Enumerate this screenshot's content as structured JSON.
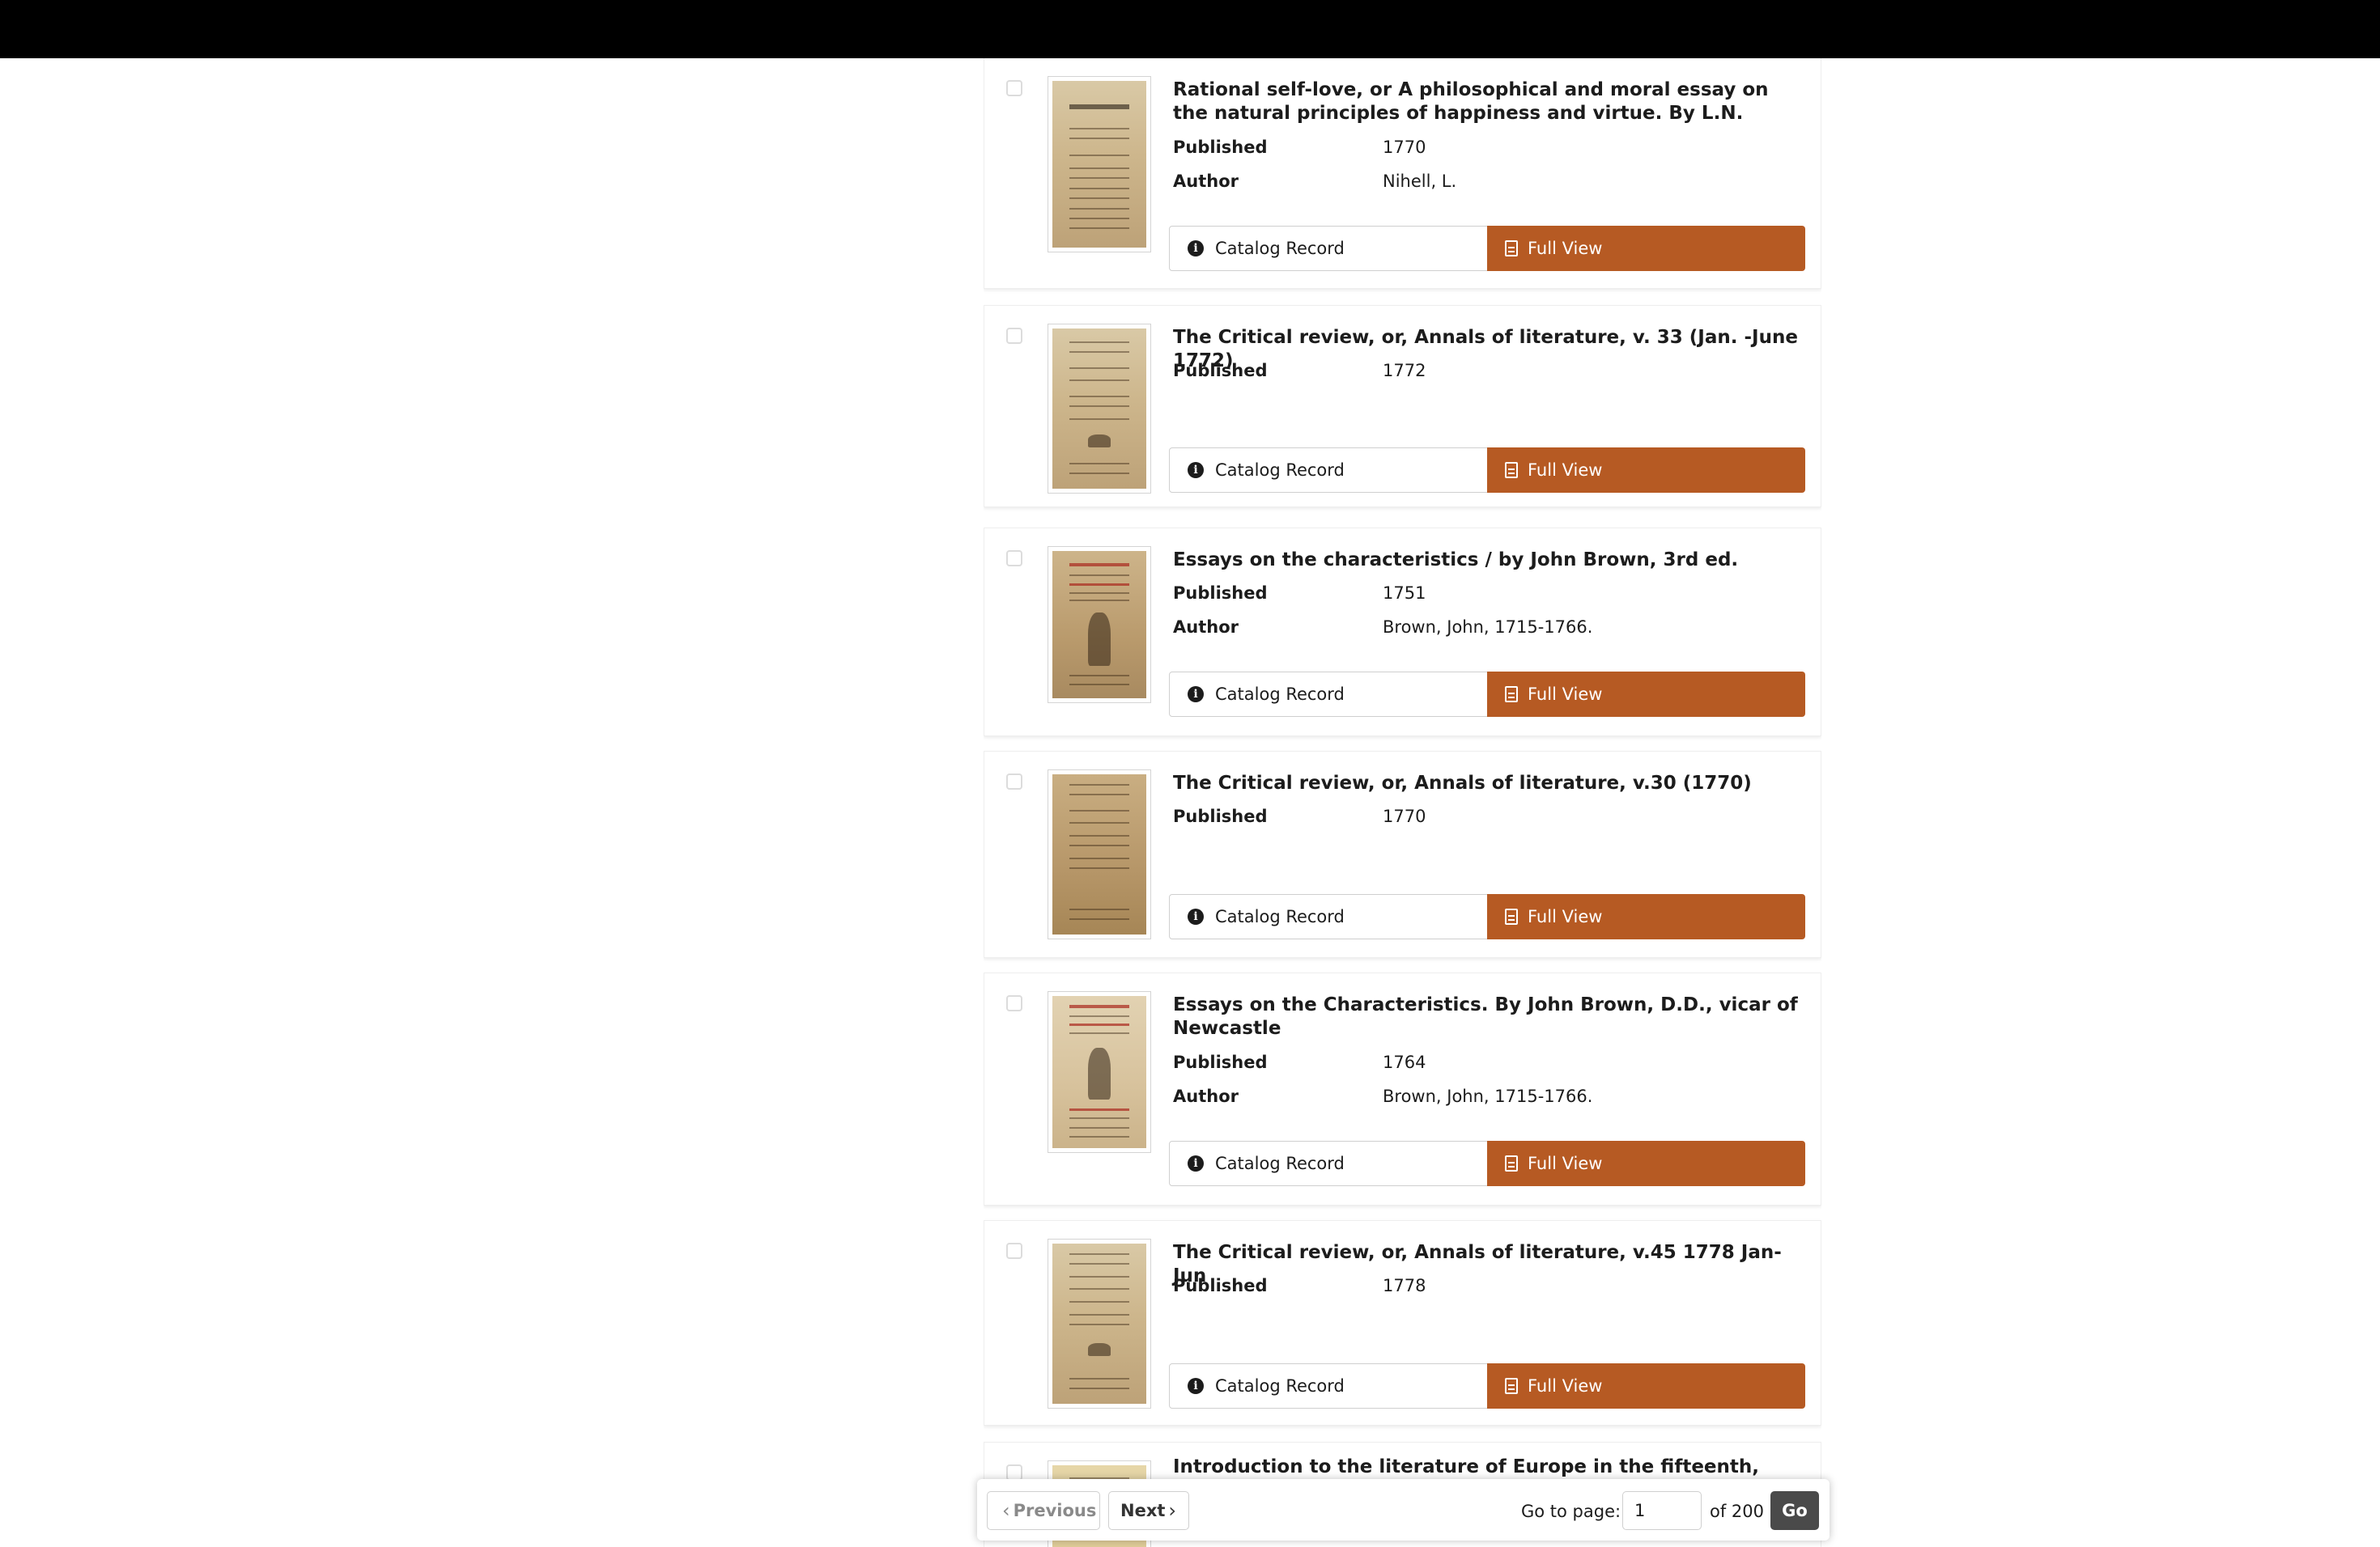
{
  "results": [
    {
      "title": "Rational self-love, or A philosophical and moral essay on the natural principles of happiness and virtue. By L.N.",
      "published_label": "Published",
      "published": "1770",
      "author_label": "Author",
      "author": "Nihell, L.",
      "catalog_label": "Catalog Record",
      "full_view_label": "Full View"
    },
    {
      "title": "The Critical review, or, Annals of literature, v. 33 (Jan. -June 1772)",
      "published_label": "Published",
      "published": "1772",
      "catalog_label": "Catalog Record",
      "full_view_label": "Full View"
    },
    {
      "title": "Essays on the characteristics / by John Brown, 3rd ed.",
      "published_label": "Published",
      "published": "1751",
      "author_label": "Author",
      "author": "Brown, John, 1715-1766.",
      "catalog_label": "Catalog Record",
      "full_view_label": "Full View"
    },
    {
      "title": "The Critical review, or, Annals of literature, v.30 (1770)",
      "published_label": "Published",
      "published": "1770",
      "catalog_label": "Catalog Record",
      "full_view_label": "Full View"
    },
    {
      "title": "Essays on the Characteristics. By John Brown, D.D., vicar of Newcastle",
      "published_label": "Published",
      "published": "1764",
      "author_label": "Author",
      "author": "Brown, John, 1715-1766.",
      "catalog_label": "Catalog Record",
      "full_view_label": "Full View"
    },
    {
      "title": "The Critical review, or, Annals of literature, v.45 1778 Jan-Jun",
      "published_label": "Published",
      "published": "1778",
      "catalog_label": "Catalog Record",
      "full_view_label": "Full View"
    },
    {
      "title": "Introduction to the literature of Europe in the fifteenth, sixteenth,"
    }
  ],
  "pagination": {
    "previous_label": "Previous",
    "next_label": "Next",
    "goto_label": "Go to page:",
    "current_page": "1",
    "of_label": "of 200",
    "go_label": "Go"
  },
  "colors": {
    "full_view_button": "#b65a23",
    "go_button": "#4a4a4a",
    "top_bar": "#000000"
  },
  "icons": {
    "catalog": "info-circle-icon",
    "full_view": "document-icon",
    "previous": "chevron-left-icon",
    "next": "chevron-right-icon"
  }
}
